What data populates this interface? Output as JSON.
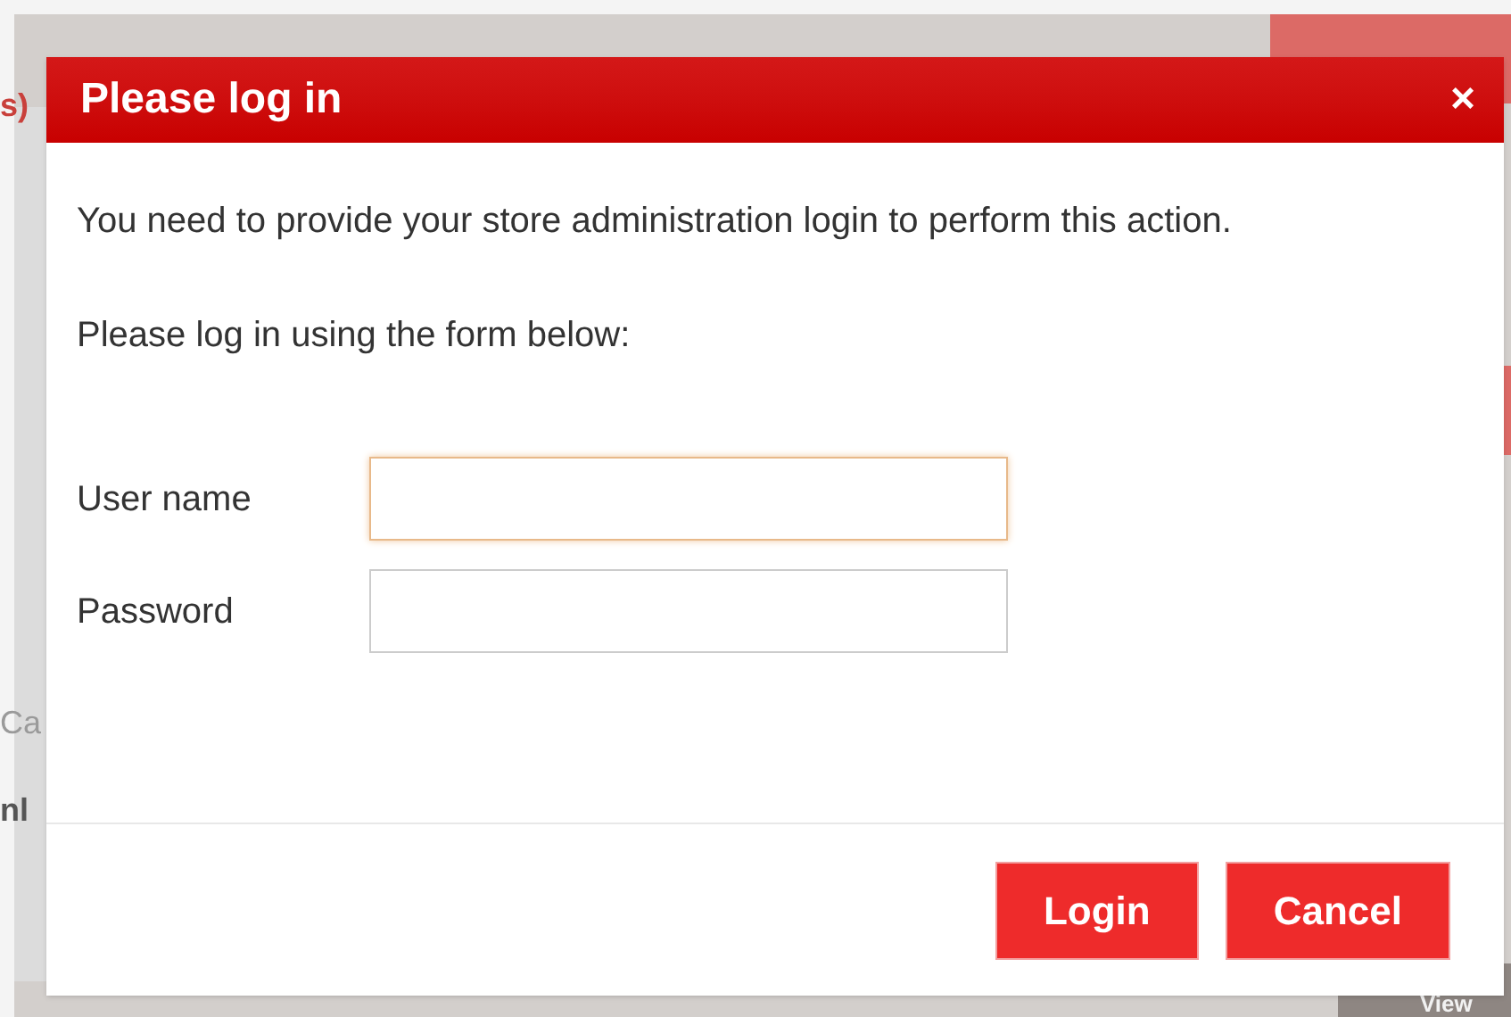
{
  "background": {
    "fragments": [
      "s)",
      "Ca",
      "nl",
      "View"
    ]
  },
  "dialog": {
    "title": "Please log in",
    "close": "×",
    "messages": [
      "You need to provide your store administration login to perform this action.",
      "Please log in using the form below:"
    ],
    "fields": [
      {
        "label": "User name",
        "focused": true
      },
      {
        "label": "Password",
        "focused": false
      }
    ],
    "buttons": [
      "Login",
      "Cancel"
    ]
  }
}
